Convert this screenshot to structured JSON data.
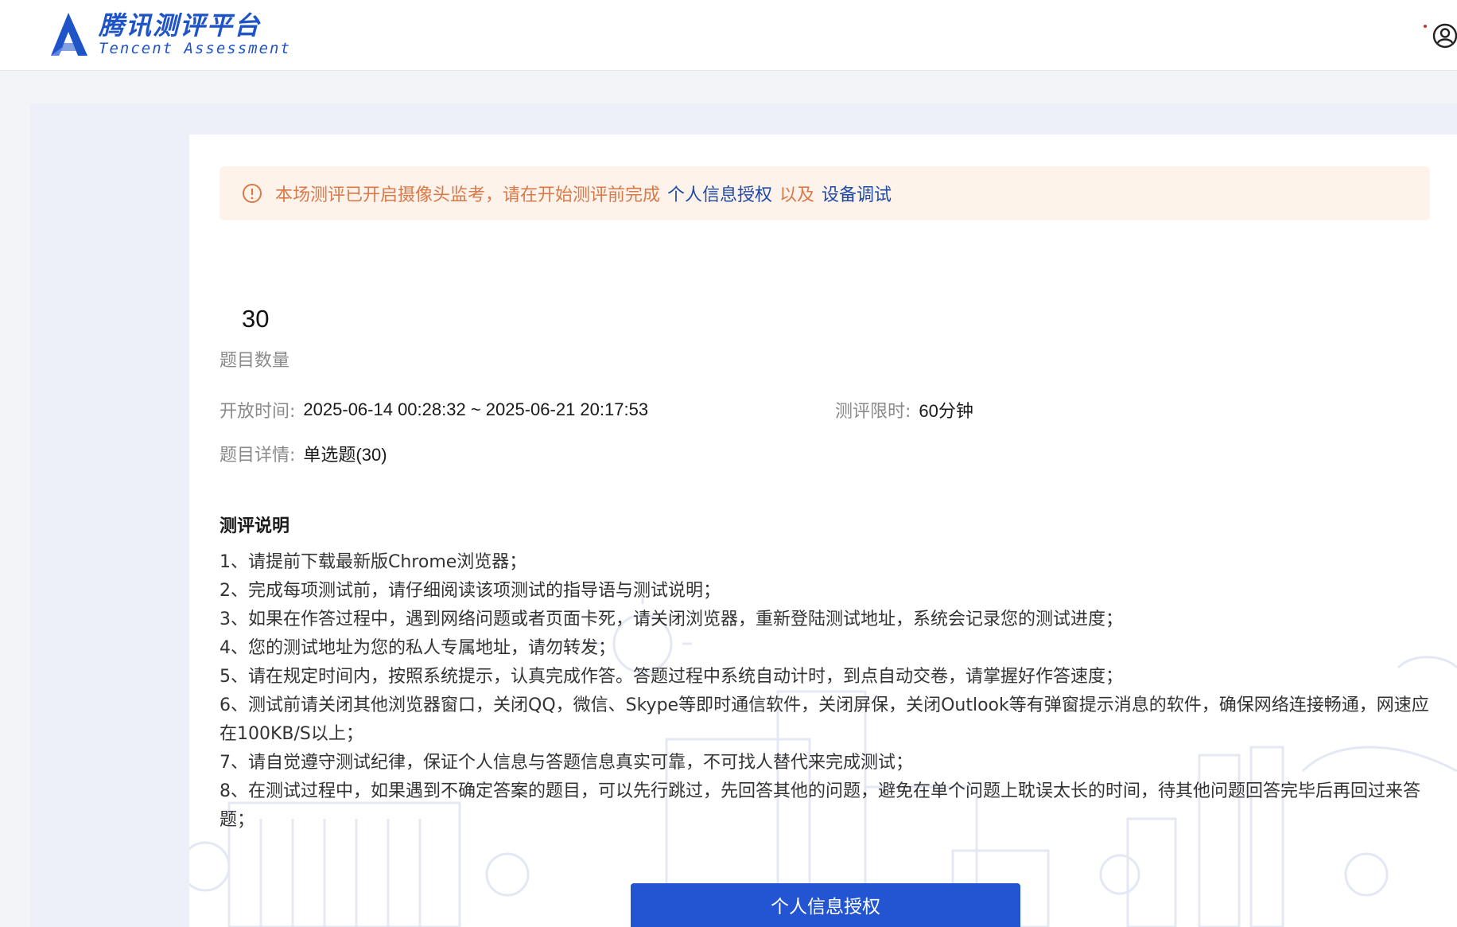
{
  "header": {
    "brand_cn": "腾讯测评平台",
    "brand_en": "Tencent Assessment",
    "logo_icon": "tencent-assessment-logo-icon",
    "user_icon": "user-avatar-icon"
  },
  "notice": {
    "icon": "warning-circle-icon",
    "prefix": "本场测评已开启摄像头监考，请在开始测评前完成",
    "link1": "个人信息授权",
    "middle": "以及",
    "link2": "设备调试"
  },
  "summary": {
    "question_count": "30",
    "question_count_label": "题目数量",
    "open_time_label": "开放时间:",
    "open_time_value": "2025-06-14 00:28:32 ~ 2025-06-21 20:17:53",
    "time_limit_label": "测评限时:",
    "time_limit_value": "60分钟",
    "detail_label": "题目详情:",
    "detail_value": "单选题(30)"
  },
  "instructions": {
    "title": "测评说明",
    "items": [
      "1、请提前下载最新版Chrome浏览器；",
      "2、完成每项测试前，请仔细阅读该项测试的指导语与测试说明；",
      "3、如果在作答过程中，遇到网络问题或者页面卡死，请关闭浏览器，重新登陆测试地址，系统会记录您的测试进度；",
      "4、您的测试地址为您的私人专属地址，请勿转发；",
      "5、请在规定时间内，按照系统提示，认真完成作答。答题过程中系统自动计时，到点自动交卷，请掌握好作答速度；",
      "6、测试前请关闭其他浏览器窗口，关闭QQ，微信、Skype等即时通信软件，关闭屏保，关闭Outlook等有弹窗提示消息的软件，确保网络连接畅通，网速应在100KB/S以上；",
      "7、请自觉遵守测试纪律，保证个人信息与答题信息真实可靠，不可找人替代来完成测试；",
      "8、在测试过程中，如果遇到不确定答案的题目，可以先行跳过，先回答其他的问题，避免在单个问题上耽误太长的时间，待其他问题回答完毕后再回过来答题；"
    ]
  },
  "actions": {
    "primary_label": "个人信息授权"
  },
  "colors": {
    "brand_blue": "#1f53c8",
    "button_blue": "#2354d1",
    "notice_bg": "#fdf3ea",
    "notice_text": "#d9794a",
    "link_blue": "#1f4aa8"
  }
}
